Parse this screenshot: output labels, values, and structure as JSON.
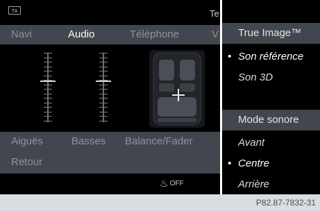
{
  "status": {
    "badge": "TA",
    "text": "Te"
  },
  "tabs": [
    "Navi",
    "Audio",
    "Téléphone",
    "V"
  ],
  "labels": {
    "treble": "Aiguës",
    "bass": "Basses",
    "balance": "Balance/Fader"
  },
  "back_label": "Retour",
  "bottom_icon": {
    "name": "seat-heating-icon",
    "label": "OFF"
  },
  "sliders": {
    "treble_level": 0.6,
    "bass_level": 0.6
  },
  "menu": {
    "section1": "True Image™",
    "items1": [
      "Son référence",
      "Son 3D"
    ],
    "selected1": "Son référence",
    "section2": "Mode sonore",
    "items2": [
      "Avant",
      "Centre",
      "Arrière"
    ],
    "selected2": "Centre",
    "bullet": "•"
  },
  "caption": "P82.87-7832-31"
}
